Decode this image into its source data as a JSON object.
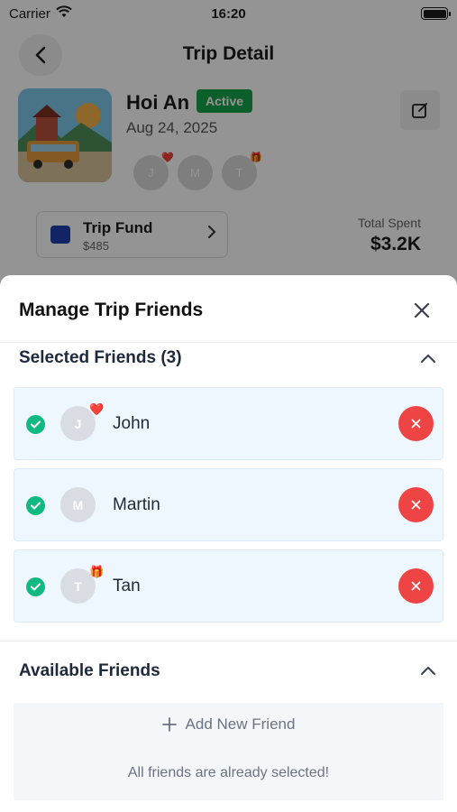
{
  "status_bar": {
    "carrier": "Carrier",
    "time": "16:20"
  },
  "trip": {
    "header_title": "Trip Detail",
    "name": "Hoi An",
    "status": "Active",
    "date": "Aug 24, 2025",
    "avatars": [
      {
        "initial": "J",
        "emoji": "❤️"
      },
      {
        "initial": "M",
        "emoji": ""
      },
      {
        "initial": "T",
        "emoji": "🎁"
      }
    ],
    "fund": {
      "title": "Trip Fund",
      "amount": "$485"
    },
    "total": {
      "label": "Total Spent",
      "value": "$3.2K"
    }
  },
  "sheet": {
    "title": "Manage Trip Friends",
    "selected_title": "Selected Friends (3)",
    "selected": [
      {
        "initial": "J",
        "name": "John",
        "emoji": "❤️"
      },
      {
        "initial": "M",
        "name": "Martin",
        "emoji": ""
      },
      {
        "initial": "T",
        "name": "Tan",
        "emoji": "🎁"
      }
    ],
    "available_title": "Available Friends",
    "add_label": "Add New Friend",
    "empty_message": "All friends are already selected!"
  },
  "colors": {
    "active_badge": "#16a34a",
    "check": "#10b981",
    "remove": "#ef4444",
    "selected_row_bg": "#eef7fe"
  }
}
